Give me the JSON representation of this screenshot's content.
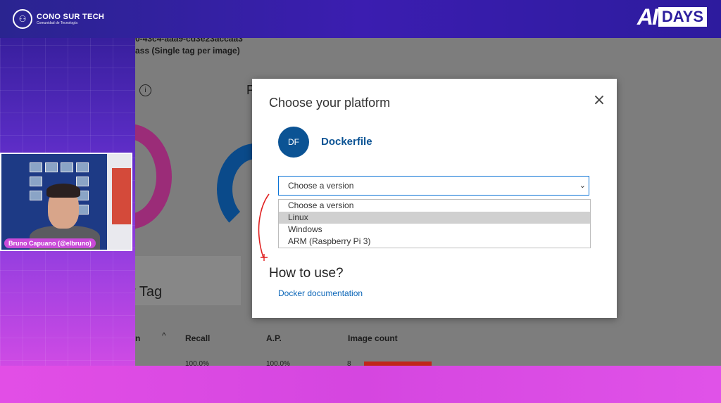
{
  "branding": {
    "org_name": "CONO SUR TECH",
    "org_sub": "Comunidad de Tecnología",
    "event_ai": "AI",
    "event_days": "DAYS"
  },
  "background_page": {
    "id_fragment": "0-43c4-aaa9-cd3e23accaa3",
    "classification_type": "ass (Single tag per image)",
    "section_fragment": "r Tag",
    "table_headers": {
      "col1": "n",
      "recall": "Recall",
      "ap": "A.P.",
      "image_count": "Image count"
    },
    "first_row": {
      "recall": "100.0%",
      "ap": "100.0%",
      "image_count": "8"
    },
    "colors": {
      "donut_pink": "#9b2c78",
      "donut_blue": "#0a4a8a",
      "bar_red": "#c0261a"
    }
  },
  "webcam": {
    "presenter_label": "Bruno Capuano (@elbruno)"
  },
  "modal": {
    "title": "Choose your platform",
    "platform_initials": "DF",
    "platform_name": "Dockerfile",
    "version_select": {
      "value": "Choose a version",
      "options": [
        "Choose a version",
        "Linux",
        "Windows",
        "ARM (Raspberry Pi 3)"
      ],
      "highlighted_index": 1
    },
    "how_to_use_heading": "How to use?",
    "docs_link": "Docker documentation",
    "colors": {
      "accent": "#0b5394",
      "link": "#0b66b8",
      "select_border": "#0b73d6"
    }
  },
  "annotation": {
    "color": "#e02020"
  }
}
